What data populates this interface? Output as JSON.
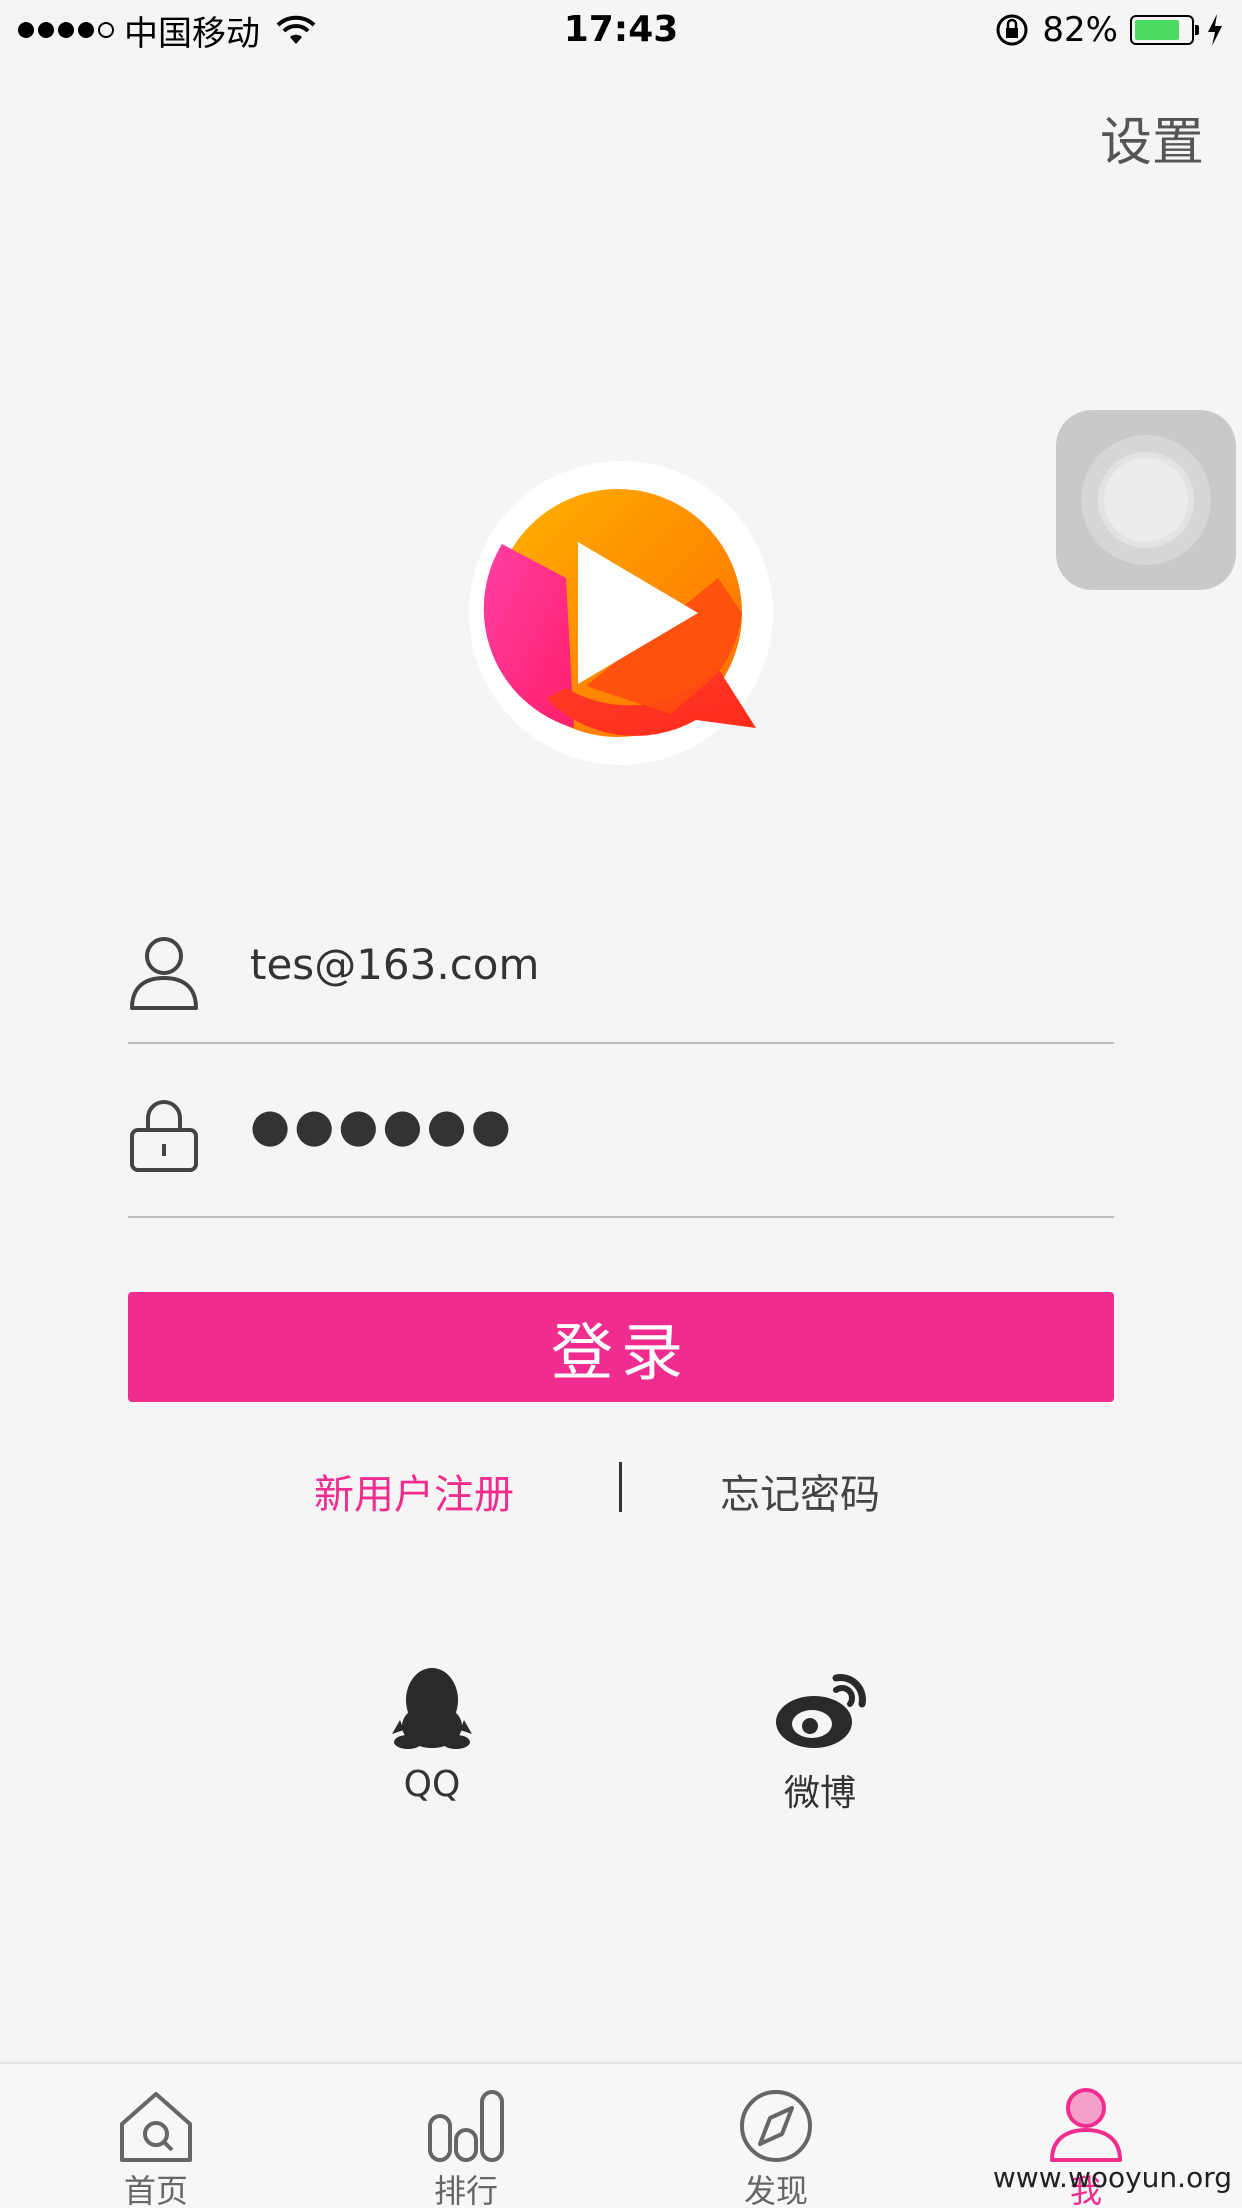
{
  "status_bar": {
    "carrier": "中国移动",
    "time": "17:43",
    "battery_pct": "82%",
    "battery_level": 0.82,
    "colors": {
      "battery": "#4cd964"
    }
  },
  "header": {
    "settings_label": "设置"
  },
  "form": {
    "account_value": "tes@163.com",
    "password_value": "●●●●●●",
    "account_icon": "user-icon",
    "password_icon": "lock-icon"
  },
  "login_button": {
    "label": "登录",
    "color": "#f02d8f"
  },
  "links": {
    "register": "新用户注册",
    "forgot": "忘记密码"
  },
  "social": [
    {
      "label": "QQ",
      "icon": "qq-penguin-icon"
    },
    {
      "label": "微博",
      "icon": "weibo-icon"
    }
  ],
  "tabbar": {
    "items": [
      {
        "label": "首页",
        "icon": "home-icon",
        "active": false
      },
      {
        "label": "排行",
        "icon": "ranking-icon",
        "active": false
      },
      {
        "label": "发现",
        "icon": "compass-icon",
        "active": false
      },
      {
        "label": "我",
        "icon": "profile-icon",
        "active": true
      }
    ],
    "accent": "#f02d8f"
  },
  "watermark": "www.wooyun.org"
}
